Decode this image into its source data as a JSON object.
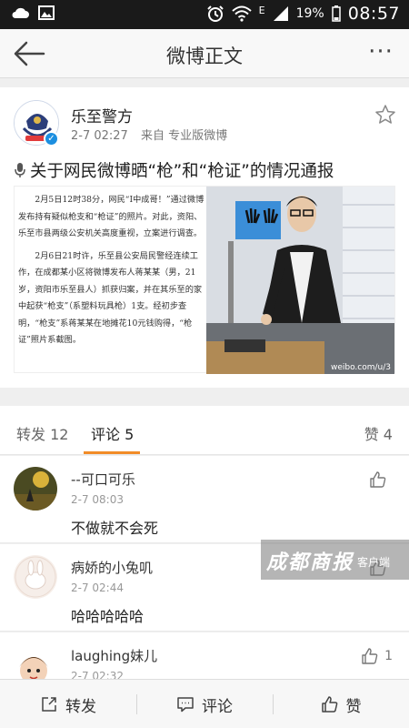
{
  "status_bar": {
    "network_letter": "E",
    "battery_percent": "19%",
    "time": "08:57"
  },
  "nav": {
    "title": "微博正文",
    "more_label": "···"
  },
  "post": {
    "username": "乐至警方",
    "time": "2-7 02:27",
    "source": "来自 专业版微博",
    "headline": "关于网民微博晒“枪”和“枪证”的情况通报",
    "article_paragraphs": [
      "2月5日12时38分，网民“Ⅰ中成哥！”通过微博发布持有疑似枪支和“枪证”的照片。对此，资阳、乐至市县两级公安机关高度重视，立案进行调查。",
      "2月6日21时许，乐至县公安局民警经连续工作，在成都某小区将微博发布人蒋某某（男，21岁，资阳市乐至县人）抓获归案，并在其乐至的家中起获“枪支”（系塑料玩具枪）1支。经初步查明，“枪支”系蒋某某在地摊花10元钱购得，“枪证”照片系截图。"
    ],
    "photo_watermark": "weibo.com/u/3"
  },
  "tabs": [
    {
      "label": "转发 12"
    },
    {
      "label": "评论 5"
    },
    {
      "label": "赞 4"
    }
  ],
  "comments": [
    {
      "name": "--可口可乐",
      "time": "2-7 08:03",
      "text": "不做就不会死",
      "likes": ""
    },
    {
      "name": "病娇的小兔叽",
      "time": "2-7 02:44",
      "text": "哈哈哈哈哈",
      "likes": ""
    },
    {
      "name": "laughing妹儿",
      "time": "2-7 02:32",
      "text": "",
      "likes": "1"
    }
  ],
  "overlay_watermark": {
    "brand": "成都商报",
    "suffix": "客户端"
  },
  "bottom_bar": {
    "repost": "转发",
    "comment": "评论",
    "like": "赞"
  },
  "colors": {
    "accent": "#f28c28",
    "verified": "#1c8fe0"
  }
}
